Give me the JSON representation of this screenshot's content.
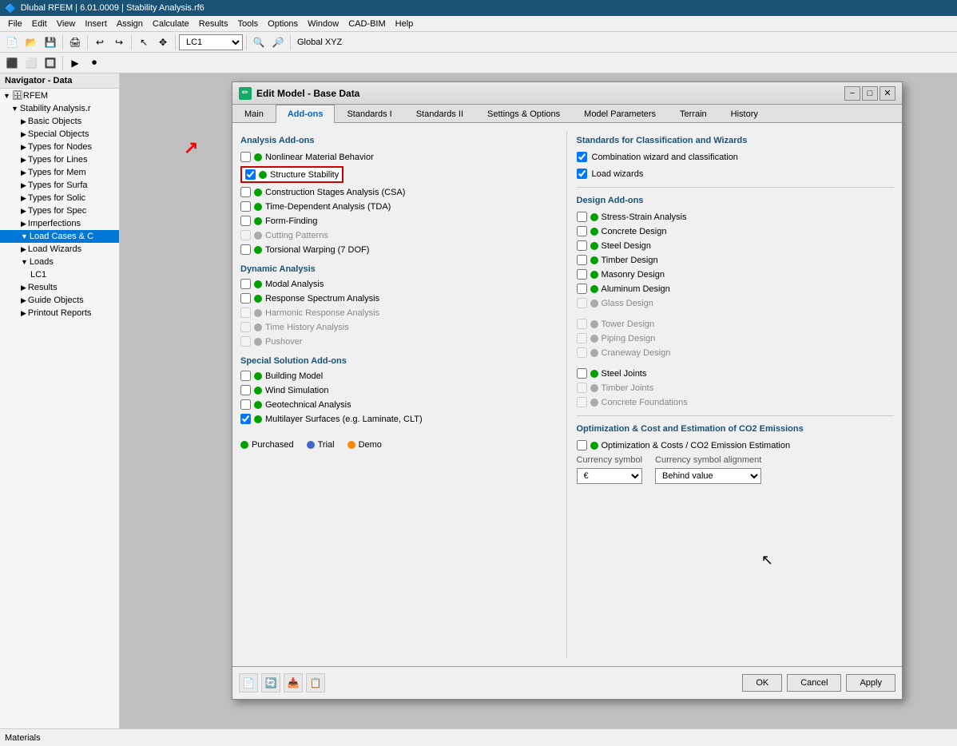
{
  "titleBar": {
    "text": "Dlubal RFEM | 6.01.0009 | Stability Analysis.rf6"
  },
  "menuBar": {
    "items": [
      "File",
      "Edit",
      "View",
      "Insert",
      "Assign",
      "Calculate",
      "Results",
      "Tools",
      "Options",
      "Window",
      "CAD-BIM",
      "Help"
    ]
  },
  "toolbar": {
    "lc_label": "LC1",
    "xyz_label": "Global XYZ"
  },
  "navigator": {
    "header": "Navigator - Data",
    "items": [
      {
        "label": "RFEM",
        "level": 0,
        "icon": "db"
      },
      {
        "label": "Stability Analysis.r",
        "level": 1,
        "icon": "file"
      },
      {
        "label": "Basic Objects",
        "level": 2
      },
      {
        "label": "Special Objects",
        "level": 2
      },
      {
        "label": "Types for Nodes",
        "level": 2
      },
      {
        "label": "Types for Lines",
        "level": 2
      },
      {
        "label": "Types for Mem",
        "level": 2
      },
      {
        "label": "Types for Surfa",
        "level": 2
      },
      {
        "label": "Types for Solic",
        "level": 2
      },
      {
        "label": "Types for Spec",
        "level": 2
      },
      {
        "label": "Imperfections",
        "level": 2
      },
      {
        "label": "Load Cases & C",
        "level": 2,
        "selected": true
      },
      {
        "label": "Load Wizards",
        "level": 2
      },
      {
        "label": "Loads",
        "level": 2
      },
      {
        "label": "LC1",
        "level": 3
      },
      {
        "label": "Results",
        "level": 2
      },
      {
        "label": "Guide Objects",
        "level": 2
      },
      {
        "label": "Printout Reports",
        "level": 2
      }
    ]
  },
  "dialog": {
    "title": "Edit Model - Base Data",
    "tabs": [
      "Main",
      "Add-ons",
      "Standards I",
      "Standards II",
      "Settings & Options",
      "Model Parameters",
      "Terrain",
      "History"
    ],
    "activeTab": "Add-ons",
    "leftPanel": {
      "analysisAddons": {
        "title": "Analysis Add-ons",
        "items": [
          {
            "checked": false,
            "dot": "green",
            "label": "Nonlinear Material Behavior",
            "disabled": false,
            "highlighted": false
          },
          {
            "checked": true,
            "dot": "green",
            "label": "Structure Stability",
            "disabled": false,
            "highlighted": true
          },
          {
            "checked": false,
            "dot": "green",
            "label": "Construction Stages Analysis (CSA)",
            "disabled": false,
            "highlighted": false
          },
          {
            "checked": false,
            "dot": "green",
            "label": "Time-Dependent Analysis (TDA)",
            "disabled": false,
            "highlighted": false
          },
          {
            "checked": false,
            "dot": "green",
            "label": "Form-Finding",
            "disabled": false,
            "highlighted": false
          },
          {
            "checked": false,
            "dot": "gray",
            "label": "Cutting Patterns",
            "disabled": true,
            "highlighted": false
          },
          {
            "checked": false,
            "dot": "green",
            "label": "Torsional Warping (7 DOF)",
            "disabled": false,
            "highlighted": false
          }
        ]
      },
      "dynamicAnalysis": {
        "title": "Dynamic Analysis",
        "items": [
          {
            "checked": false,
            "dot": "green",
            "label": "Modal Analysis",
            "disabled": false
          },
          {
            "checked": false,
            "dot": "green",
            "label": "Response Spectrum Analysis",
            "disabled": false
          },
          {
            "checked": false,
            "dot": "gray",
            "label": "Harmonic Response Analysis",
            "disabled": true
          },
          {
            "checked": false,
            "dot": "gray",
            "label": "Time History Analysis",
            "disabled": true
          },
          {
            "checked": false,
            "dot": "gray",
            "label": "Pushover",
            "disabled": true
          }
        ]
      },
      "specialSolution": {
        "title": "Special Solution Add-ons",
        "items": [
          {
            "checked": false,
            "dot": "green",
            "label": "Building Model",
            "disabled": false
          },
          {
            "checked": false,
            "dot": "green",
            "label": "Wind Simulation",
            "disabled": false
          },
          {
            "checked": false,
            "dot": "green",
            "label": "Geotechnical Analysis",
            "disabled": false
          },
          {
            "checked": true,
            "dot": "green",
            "label": "Multilayer Surfaces (e.g. Laminate, CLT)",
            "disabled": false
          }
        ]
      },
      "legend": {
        "items": [
          {
            "dot": "green",
            "label": "Purchased"
          },
          {
            "dot": "blue",
            "label": "Trial"
          },
          {
            "dot": "orange",
            "label": "Demo"
          }
        ]
      }
    },
    "rightPanel": {
      "standards": {
        "title": "Standards for Classification and Wizards",
        "items": [
          {
            "checked": true,
            "label": "Combination wizard and classification"
          },
          {
            "checked": true,
            "label": "Load wizards"
          }
        ]
      },
      "designAddons": {
        "title": "Design Add-ons",
        "items": [
          {
            "checked": false,
            "dot": "green",
            "label": "Stress-Strain Analysis",
            "disabled": false
          },
          {
            "checked": false,
            "dot": "green",
            "label": "Concrete Design",
            "disabled": false
          },
          {
            "checked": false,
            "dot": "green",
            "label": "Steel Design",
            "disabled": false
          },
          {
            "checked": false,
            "dot": "green",
            "label": "Timber Design",
            "disabled": false
          },
          {
            "checked": false,
            "dot": "green",
            "label": "Masonry Design",
            "disabled": false
          },
          {
            "checked": false,
            "dot": "green",
            "label": "Aluminum Design",
            "disabled": false
          },
          {
            "checked": false,
            "dot": "gray",
            "label": "Glass Design",
            "disabled": true
          },
          {
            "checked": false,
            "dot": "gray",
            "label": "Tower Design",
            "disabled": true
          },
          {
            "checked": false,
            "dot": "gray",
            "label": "Piping Design",
            "disabled": true
          },
          {
            "checked": false,
            "dot": "gray",
            "label": "Craneway Design",
            "disabled": true
          },
          {
            "checked": false,
            "dot": "green",
            "label": "Steel Joints",
            "disabled": false
          },
          {
            "checked": false,
            "dot": "gray",
            "label": "Timber Joints",
            "disabled": true
          },
          {
            "checked": false,
            "dot": "gray",
            "label": "Concrete Foundations",
            "disabled": true
          }
        ]
      },
      "optimization": {
        "title": "Optimization & Cost and Estimation of CO2 Emissions",
        "items": [
          {
            "checked": false,
            "dot": "green",
            "label": "Optimization & Costs / CO2 Emission Estimation",
            "disabled": false
          }
        ],
        "currencySymbolLabel": "Currency symbol",
        "currencyAlignmentLabel": "Currency symbol alignment",
        "currencyValue": "€",
        "alignmentValue": "Behind value"
      }
    },
    "footer": {
      "icons": [
        "📄",
        "🔄",
        "📥",
        "📋"
      ],
      "buttons": {
        "ok": "OK",
        "cancel": "Cancel",
        "apply": "Apply"
      }
    }
  },
  "statusBar": {
    "text": "Materials"
  }
}
